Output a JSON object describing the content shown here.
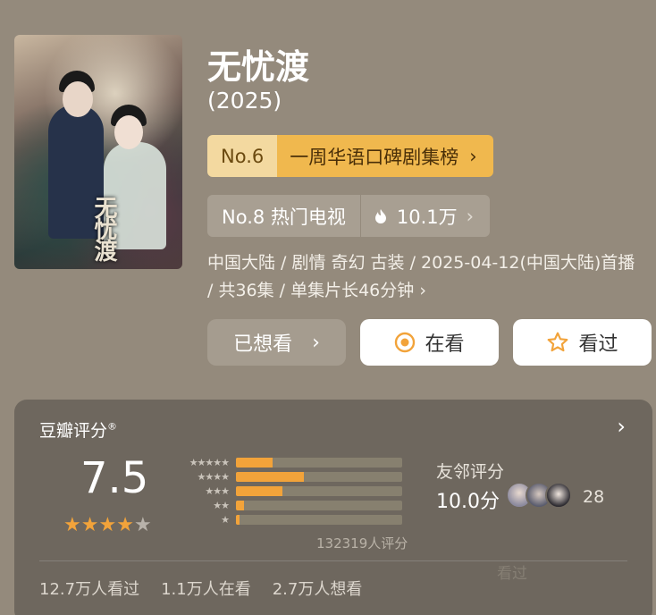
{
  "title": "无忧渡",
  "year": "(2025)",
  "poster_title": "无忧渡",
  "rank_primary": {
    "no": "No.6",
    "name": "一周华语口碑剧集榜",
    "arrow": "›"
  },
  "rank_secondary": {
    "label": "No.8 热门电视",
    "heat": "10.1万",
    "arrow": "›"
  },
  "meta": "中国大陆 / 剧情 奇幻 古装 / 2025-04-12(中国大陆)首播 / 共36集 / 单集片长46分钟 ›",
  "buttons": {
    "wish": {
      "label": "已想看",
      "arrow": "›"
    },
    "watching": {
      "label": "在看"
    },
    "watched": {
      "label": "看过"
    }
  },
  "rating": {
    "label": "豆瓣评分",
    "reg": "®",
    "arrow": "›",
    "score": "7.5",
    "star_count": 4,
    "distribution": [
      {
        "stars": "★★★★★",
        "fraction": 0.22
      },
      {
        "stars": "★★★★",
        "fraction": 0.41
      },
      {
        "stars": "★★★",
        "fraction": 0.28
      },
      {
        "stars": "★★",
        "fraction": 0.05
      },
      {
        "stars": "★",
        "fraction": 0.02
      }
    ],
    "count": "132319人评分"
  },
  "friends": {
    "label": "友邻评分",
    "score": "10.0分",
    "count": "28"
  },
  "stats": [
    "12.7万人看过",
    "1.1万人在看",
    "2.7万人想看"
  ],
  "watermark": "看过",
  "colors": {
    "accent": "#f2a33a",
    "background": "#948a7c",
    "panel": "#6e675e"
  }
}
